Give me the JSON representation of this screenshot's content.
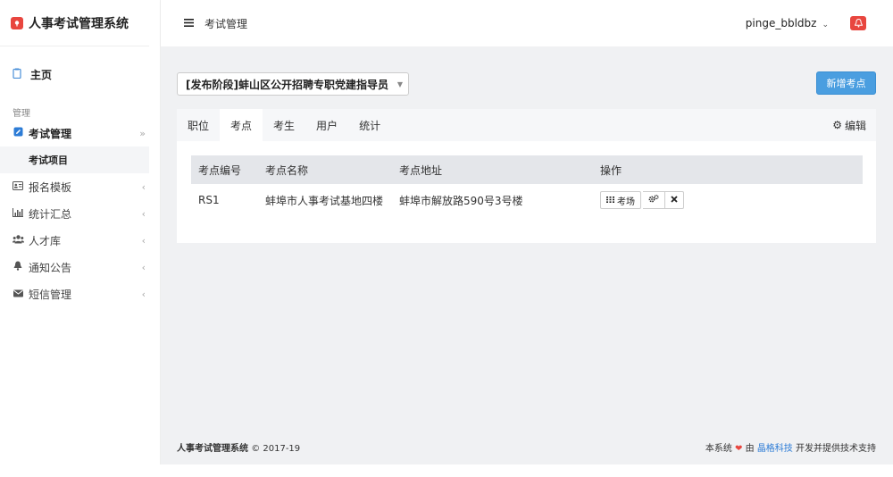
{
  "app": {
    "title": "人事考试管理系统"
  },
  "sidebar": {
    "home": "主页",
    "section": "管理",
    "items": [
      {
        "label": "考试管理",
        "icon": "edit-icon"
      },
      {
        "label": "报名模板",
        "icon": "id-card-icon"
      },
      {
        "label": "统计汇总",
        "icon": "bar-chart-icon"
      },
      {
        "label": "人才库",
        "icon": "users-icon"
      },
      {
        "label": "通知公告",
        "icon": "bell-icon"
      },
      {
        "label": "短信管理",
        "icon": "envelope-icon"
      }
    ],
    "sub_item": "考试项目"
  },
  "header": {
    "title": "考试管理",
    "user": "pinge_bbldbz"
  },
  "main": {
    "exam_select": "[发布阶段]蚌山区公开招聘专职党建指导员",
    "add_button": "新增考点",
    "tabs": [
      "职位",
      "考点",
      "考生",
      "用户",
      "统计"
    ],
    "active_tab": "考点",
    "edit": "编辑",
    "table": {
      "headers": [
        "考点编号",
        "考点名称",
        "考点地址",
        "操作"
      ],
      "rows": [
        {
          "code": "RS1",
          "name": "蚌埠市人事考试基地四楼",
          "address": "蚌埠市解放路590号3号楼",
          "room_button": "考场"
        }
      ]
    }
  },
  "footer": {
    "copyright_name": "人事考试管理系统",
    "copyright_year": "© 2017-19",
    "powered_pre": "本系统",
    "powered_by": "由",
    "company": "晶格科技",
    "powered_post": "开发并提供技术支持"
  },
  "colors": {
    "accent": "#4a9ee0",
    "brand": "#e8463f"
  }
}
